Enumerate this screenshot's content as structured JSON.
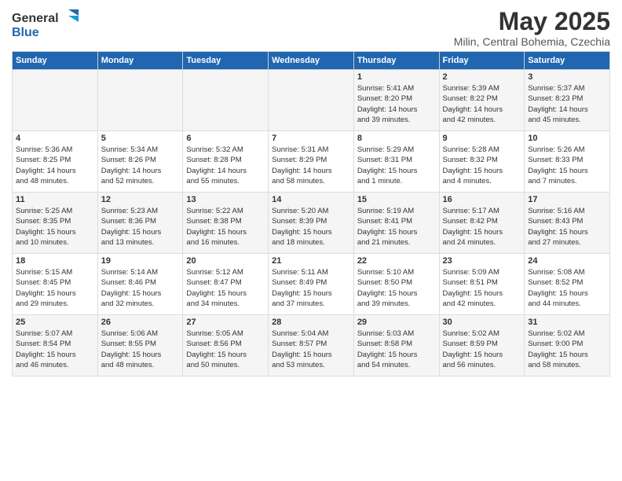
{
  "header": {
    "logo_general": "General",
    "logo_blue": "Blue",
    "title": "May 2025",
    "subtitle": "Milin, Central Bohemia, Czechia"
  },
  "days_of_week": [
    "Sunday",
    "Monday",
    "Tuesday",
    "Wednesday",
    "Thursday",
    "Friday",
    "Saturday"
  ],
  "weeks": [
    [
      {
        "day": "",
        "info": ""
      },
      {
        "day": "",
        "info": ""
      },
      {
        "day": "",
        "info": ""
      },
      {
        "day": "",
        "info": ""
      },
      {
        "day": "1",
        "info": "Sunrise: 5:41 AM\nSunset: 8:20 PM\nDaylight: 14 hours\nand 39 minutes."
      },
      {
        "day": "2",
        "info": "Sunrise: 5:39 AM\nSunset: 8:22 PM\nDaylight: 14 hours\nand 42 minutes."
      },
      {
        "day": "3",
        "info": "Sunrise: 5:37 AM\nSunset: 8:23 PM\nDaylight: 14 hours\nand 45 minutes."
      }
    ],
    [
      {
        "day": "4",
        "info": "Sunrise: 5:36 AM\nSunset: 8:25 PM\nDaylight: 14 hours\nand 48 minutes."
      },
      {
        "day": "5",
        "info": "Sunrise: 5:34 AM\nSunset: 8:26 PM\nDaylight: 14 hours\nand 52 minutes."
      },
      {
        "day": "6",
        "info": "Sunrise: 5:32 AM\nSunset: 8:28 PM\nDaylight: 14 hours\nand 55 minutes."
      },
      {
        "day": "7",
        "info": "Sunrise: 5:31 AM\nSunset: 8:29 PM\nDaylight: 14 hours\nand 58 minutes."
      },
      {
        "day": "8",
        "info": "Sunrise: 5:29 AM\nSunset: 8:31 PM\nDaylight: 15 hours\nand 1 minute."
      },
      {
        "day": "9",
        "info": "Sunrise: 5:28 AM\nSunset: 8:32 PM\nDaylight: 15 hours\nand 4 minutes."
      },
      {
        "day": "10",
        "info": "Sunrise: 5:26 AM\nSunset: 8:33 PM\nDaylight: 15 hours\nand 7 minutes."
      }
    ],
    [
      {
        "day": "11",
        "info": "Sunrise: 5:25 AM\nSunset: 8:35 PM\nDaylight: 15 hours\nand 10 minutes."
      },
      {
        "day": "12",
        "info": "Sunrise: 5:23 AM\nSunset: 8:36 PM\nDaylight: 15 hours\nand 13 minutes."
      },
      {
        "day": "13",
        "info": "Sunrise: 5:22 AM\nSunset: 8:38 PM\nDaylight: 15 hours\nand 16 minutes."
      },
      {
        "day": "14",
        "info": "Sunrise: 5:20 AM\nSunset: 8:39 PM\nDaylight: 15 hours\nand 18 minutes."
      },
      {
        "day": "15",
        "info": "Sunrise: 5:19 AM\nSunset: 8:41 PM\nDaylight: 15 hours\nand 21 minutes."
      },
      {
        "day": "16",
        "info": "Sunrise: 5:17 AM\nSunset: 8:42 PM\nDaylight: 15 hours\nand 24 minutes."
      },
      {
        "day": "17",
        "info": "Sunrise: 5:16 AM\nSunset: 8:43 PM\nDaylight: 15 hours\nand 27 minutes."
      }
    ],
    [
      {
        "day": "18",
        "info": "Sunrise: 5:15 AM\nSunset: 8:45 PM\nDaylight: 15 hours\nand 29 minutes."
      },
      {
        "day": "19",
        "info": "Sunrise: 5:14 AM\nSunset: 8:46 PM\nDaylight: 15 hours\nand 32 minutes."
      },
      {
        "day": "20",
        "info": "Sunrise: 5:12 AM\nSunset: 8:47 PM\nDaylight: 15 hours\nand 34 minutes."
      },
      {
        "day": "21",
        "info": "Sunrise: 5:11 AM\nSunset: 8:49 PM\nDaylight: 15 hours\nand 37 minutes."
      },
      {
        "day": "22",
        "info": "Sunrise: 5:10 AM\nSunset: 8:50 PM\nDaylight: 15 hours\nand 39 minutes."
      },
      {
        "day": "23",
        "info": "Sunrise: 5:09 AM\nSunset: 8:51 PM\nDaylight: 15 hours\nand 42 minutes."
      },
      {
        "day": "24",
        "info": "Sunrise: 5:08 AM\nSunset: 8:52 PM\nDaylight: 15 hours\nand 44 minutes."
      }
    ],
    [
      {
        "day": "25",
        "info": "Sunrise: 5:07 AM\nSunset: 8:54 PM\nDaylight: 15 hours\nand 46 minutes."
      },
      {
        "day": "26",
        "info": "Sunrise: 5:06 AM\nSunset: 8:55 PM\nDaylight: 15 hours\nand 48 minutes."
      },
      {
        "day": "27",
        "info": "Sunrise: 5:05 AM\nSunset: 8:56 PM\nDaylight: 15 hours\nand 50 minutes."
      },
      {
        "day": "28",
        "info": "Sunrise: 5:04 AM\nSunset: 8:57 PM\nDaylight: 15 hours\nand 53 minutes."
      },
      {
        "day": "29",
        "info": "Sunrise: 5:03 AM\nSunset: 8:58 PM\nDaylight: 15 hours\nand 54 minutes."
      },
      {
        "day": "30",
        "info": "Sunrise: 5:02 AM\nSunset: 8:59 PM\nDaylight: 15 hours\nand 56 minutes."
      },
      {
        "day": "31",
        "info": "Sunrise: 5:02 AM\nSunset: 9:00 PM\nDaylight: 15 hours\nand 58 minutes."
      }
    ]
  ]
}
